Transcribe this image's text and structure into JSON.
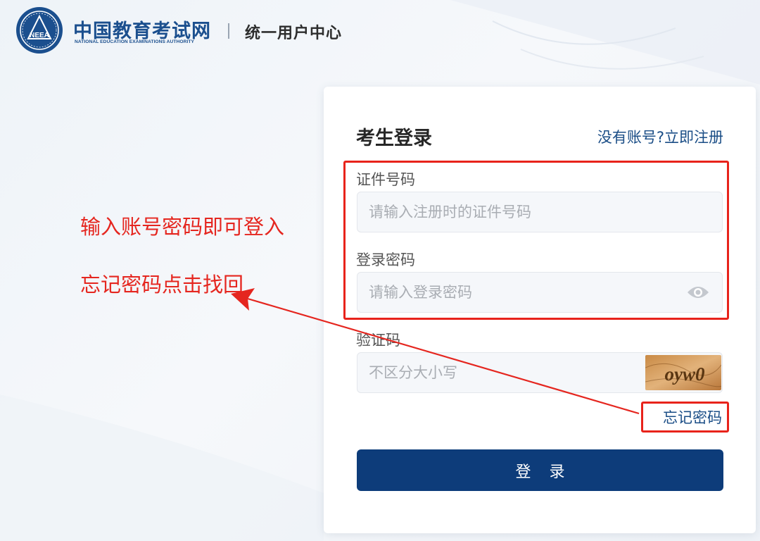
{
  "header": {
    "brand_cn": "中国教育考试网",
    "brand_en": "NATIONAL EDUCATION EXAMINATIONS AUTHORITY",
    "logo_text": "NEEA",
    "center_title": "统一用户中心"
  },
  "annotation": {
    "line1": "输入账号密码即可登入",
    "line2": "忘记密码点击找回",
    "color": "#e5261f"
  },
  "login": {
    "title": "考生登录",
    "register_link": "没有账号?立即注册",
    "id_label": "证件号码",
    "id_placeholder": "请输入注册时的证件号码",
    "password_label": "登录密码",
    "password_placeholder": "请输入登录密码",
    "captcha_label": "验证码",
    "captcha_placeholder": "不区分大小写",
    "captcha_text": "oyw0",
    "forgot_link": "忘记密码",
    "submit_label": "登录",
    "button_color": "#0d3c7a",
    "link_color": "#1a4d86"
  }
}
